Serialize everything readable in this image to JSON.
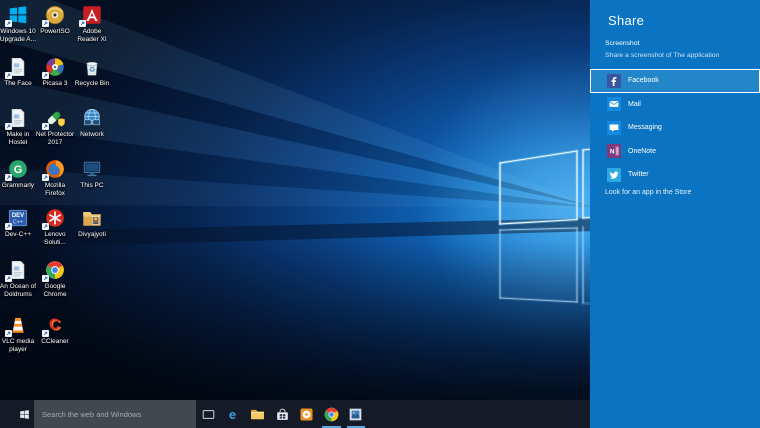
{
  "colors": {
    "panel_blue": "#0a74c2",
    "selected_row_blue": "#2386c9",
    "selected_row_border": "#ffffff",
    "taskbar_bg": "#141b26",
    "search_box_bg": "#43484f",
    "running_underline": "#5fa8dd",
    "desktop_label_text": "#ffffff"
  },
  "share_panel": {
    "title": "Share",
    "subtitle": "Screenshot",
    "description": "Share a screenshot of The application",
    "store_link": "Look for an app in the Store",
    "targets": [
      {
        "label": "Facebook",
        "icon": "facebook",
        "selected": true
      },
      {
        "label": "Mail",
        "icon": "mail",
        "selected": false
      },
      {
        "label": "Messaging",
        "icon": "messaging",
        "selected": false
      },
      {
        "label": "OneNote",
        "icon": "onenote",
        "selected": false
      },
      {
        "label": "Twitter",
        "icon": "twitter",
        "selected": false
      }
    ]
  },
  "desktop": {
    "icons": [
      {
        "lines": [
          "Windows 10",
          "Upgrade A..."
        ],
        "icon": "windows",
        "shortcut": true,
        "row": 0,
        "col": 0
      },
      {
        "lines": [
          "PowerISO"
        ],
        "icon": "disc",
        "shortcut": true,
        "row": 0,
        "col": 1
      },
      {
        "lines": [
          "Adobe",
          "Reader XI"
        ],
        "icon": "adobe-reader",
        "shortcut": true,
        "row": 0,
        "col": 2
      },
      {
        "lines": [
          "The Face"
        ],
        "icon": "document",
        "shortcut": true,
        "row": 1,
        "col": 0
      },
      {
        "lines": [
          "Picasa 3"
        ],
        "icon": "picasa",
        "shortcut": true,
        "row": 1,
        "col": 1
      },
      {
        "lines": [
          "Recycle Bin"
        ],
        "icon": "recycle-bin",
        "shortcut": false,
        "row": 1,
        "col": 2
      },
      {
        "lines": [
          "Make in",
          "Hostel"
        ],
        "icon": "document",
        "shortcut": true,
        "row": 2,
        "col": 0
      },
      {
        "lines": [
          "Net Protector",
          "2017"
        ],
        "icon": "net-protector",
        "shortcut": true,
        "row": 2,
        "col": 1
      },
      {
        "lines": [
          "Network"
        ],
        "icon": "network",
        "shortcut": false,
        "row": 2,
        "col": 2
      },
      {
        "lines": [
          "Grammarly"
        ],
        "icon": "grammarly",
        "shortcut": true,
        "row": 3,
        "col": 0
      },
      {
        "lines": [
          "Mozilla",
          "Firefox"
        ],
        "icon": "firefox",
        "shortcut": true,
        "row": 3,
        "col": 1
      },
      {
        "lines": [
          "This PC"
        ],
        "icon": "this-pc",
        "shortcut": false,
        "row": 3,
        "col": 2
      },
      {
        "lines": [
          "Dev-C++"
        ],
        "icon": "dev-cpp",
        "shortcut": true,
        "row": 4,
        "col": 0
      },
      {
        "lines": [
          "Lenovo",
          "Soluti..."
        ],
        "icon": "lenovo",
        "shortcut": true,
        "row": 4,
        "col": 1
      },
      {
        "lines": [
          "Divyajyoti"
        ],
        "icon": "user-folder",
        "shortcut": false,
        "row": 4,
        "col": 2
      },
      {
        "lines": [
          "An Ocean of",
          "Doldrums"
        ],
        "icon": "document",
        "shortcut": true,
        "row": 5,
        "col": 0
      },
      {
        "lines": [
          "Google",
          "Chrome"
        ],
        "icon": "chrome",
        "shortcut": true,
        "row": 5,
        "col": 1
      },
      {
        "lines": [
          "VLC media",
          "player"
        ],
        "icon": "vlc",
        "shortcut": true,
        "row": 6,
        "col": 0
      },
      {
        "lines": [
          "CCleaner"
        ],
        "icon": "ccleaner",
        "shortcut": true,
        "row": 6,
        "col": 1
      }
    ]
  },
  "taskbar": {
    "search_placeholder": "Search the web and Windows",
    "apps": [
      {
        "name": "task-view",
        "running": false
      },
      {
        "name": "edge",
        "running": false
      },
      {
        "name": "file-explorer",
        "running": false
      },
      {
        "name": "store",
        "running": false
      },
      {
        "name": "media-player",
        "running": false
      },
      {
        "name": "chrome",
        "running": true
      },
      {
        "name": "photos",
        "running": true
      }
    ]
  }
}
